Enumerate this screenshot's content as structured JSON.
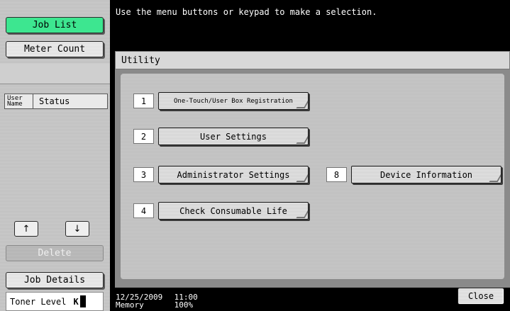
{
  "left_panel": {
    "job_list_label": "Job List",
    "meter_count_label": "Meter Count",
    "columns": {
      "user_name": "User Name",
      "status": "Status"
    },
    "scroll_up_icon": "↑",
    "scroll_down_icon": "↓",
    "delete_label": "Delete",
    "job_details_label": "Job Details",
    "toner_label": "Toner Level",
    "toner_color_letter": "K"
  },
  "header": {
    "message": "Use the menu buttons or keypad to make a selection."
  },
  "utility": {
    "title": "Utility",
    "items": [
      {
        "number": "1",
        "label": "One-Touch/User Box Registration"
      },
      {
        "number": "2",
        "label": "User Settings"
      },
      {
        "number": "3",
        "label": "Administrator Settings"
      },
      {
        "number": "4",
        "label": "Check Consumable Life"
      },
      {
        "number": "8",
        "label": "Device Information"
      }
    ]
  },
  "footer": {
    "date": "12/25/2009",
    "time": "11:00",
    "memory_label": "Memory",
    "memory_value": "100%",
    "close_label": "Close"
  },
  "colors": {
    "job_list_accent": "#3de690",
    "background": "#000000"
  }
}
